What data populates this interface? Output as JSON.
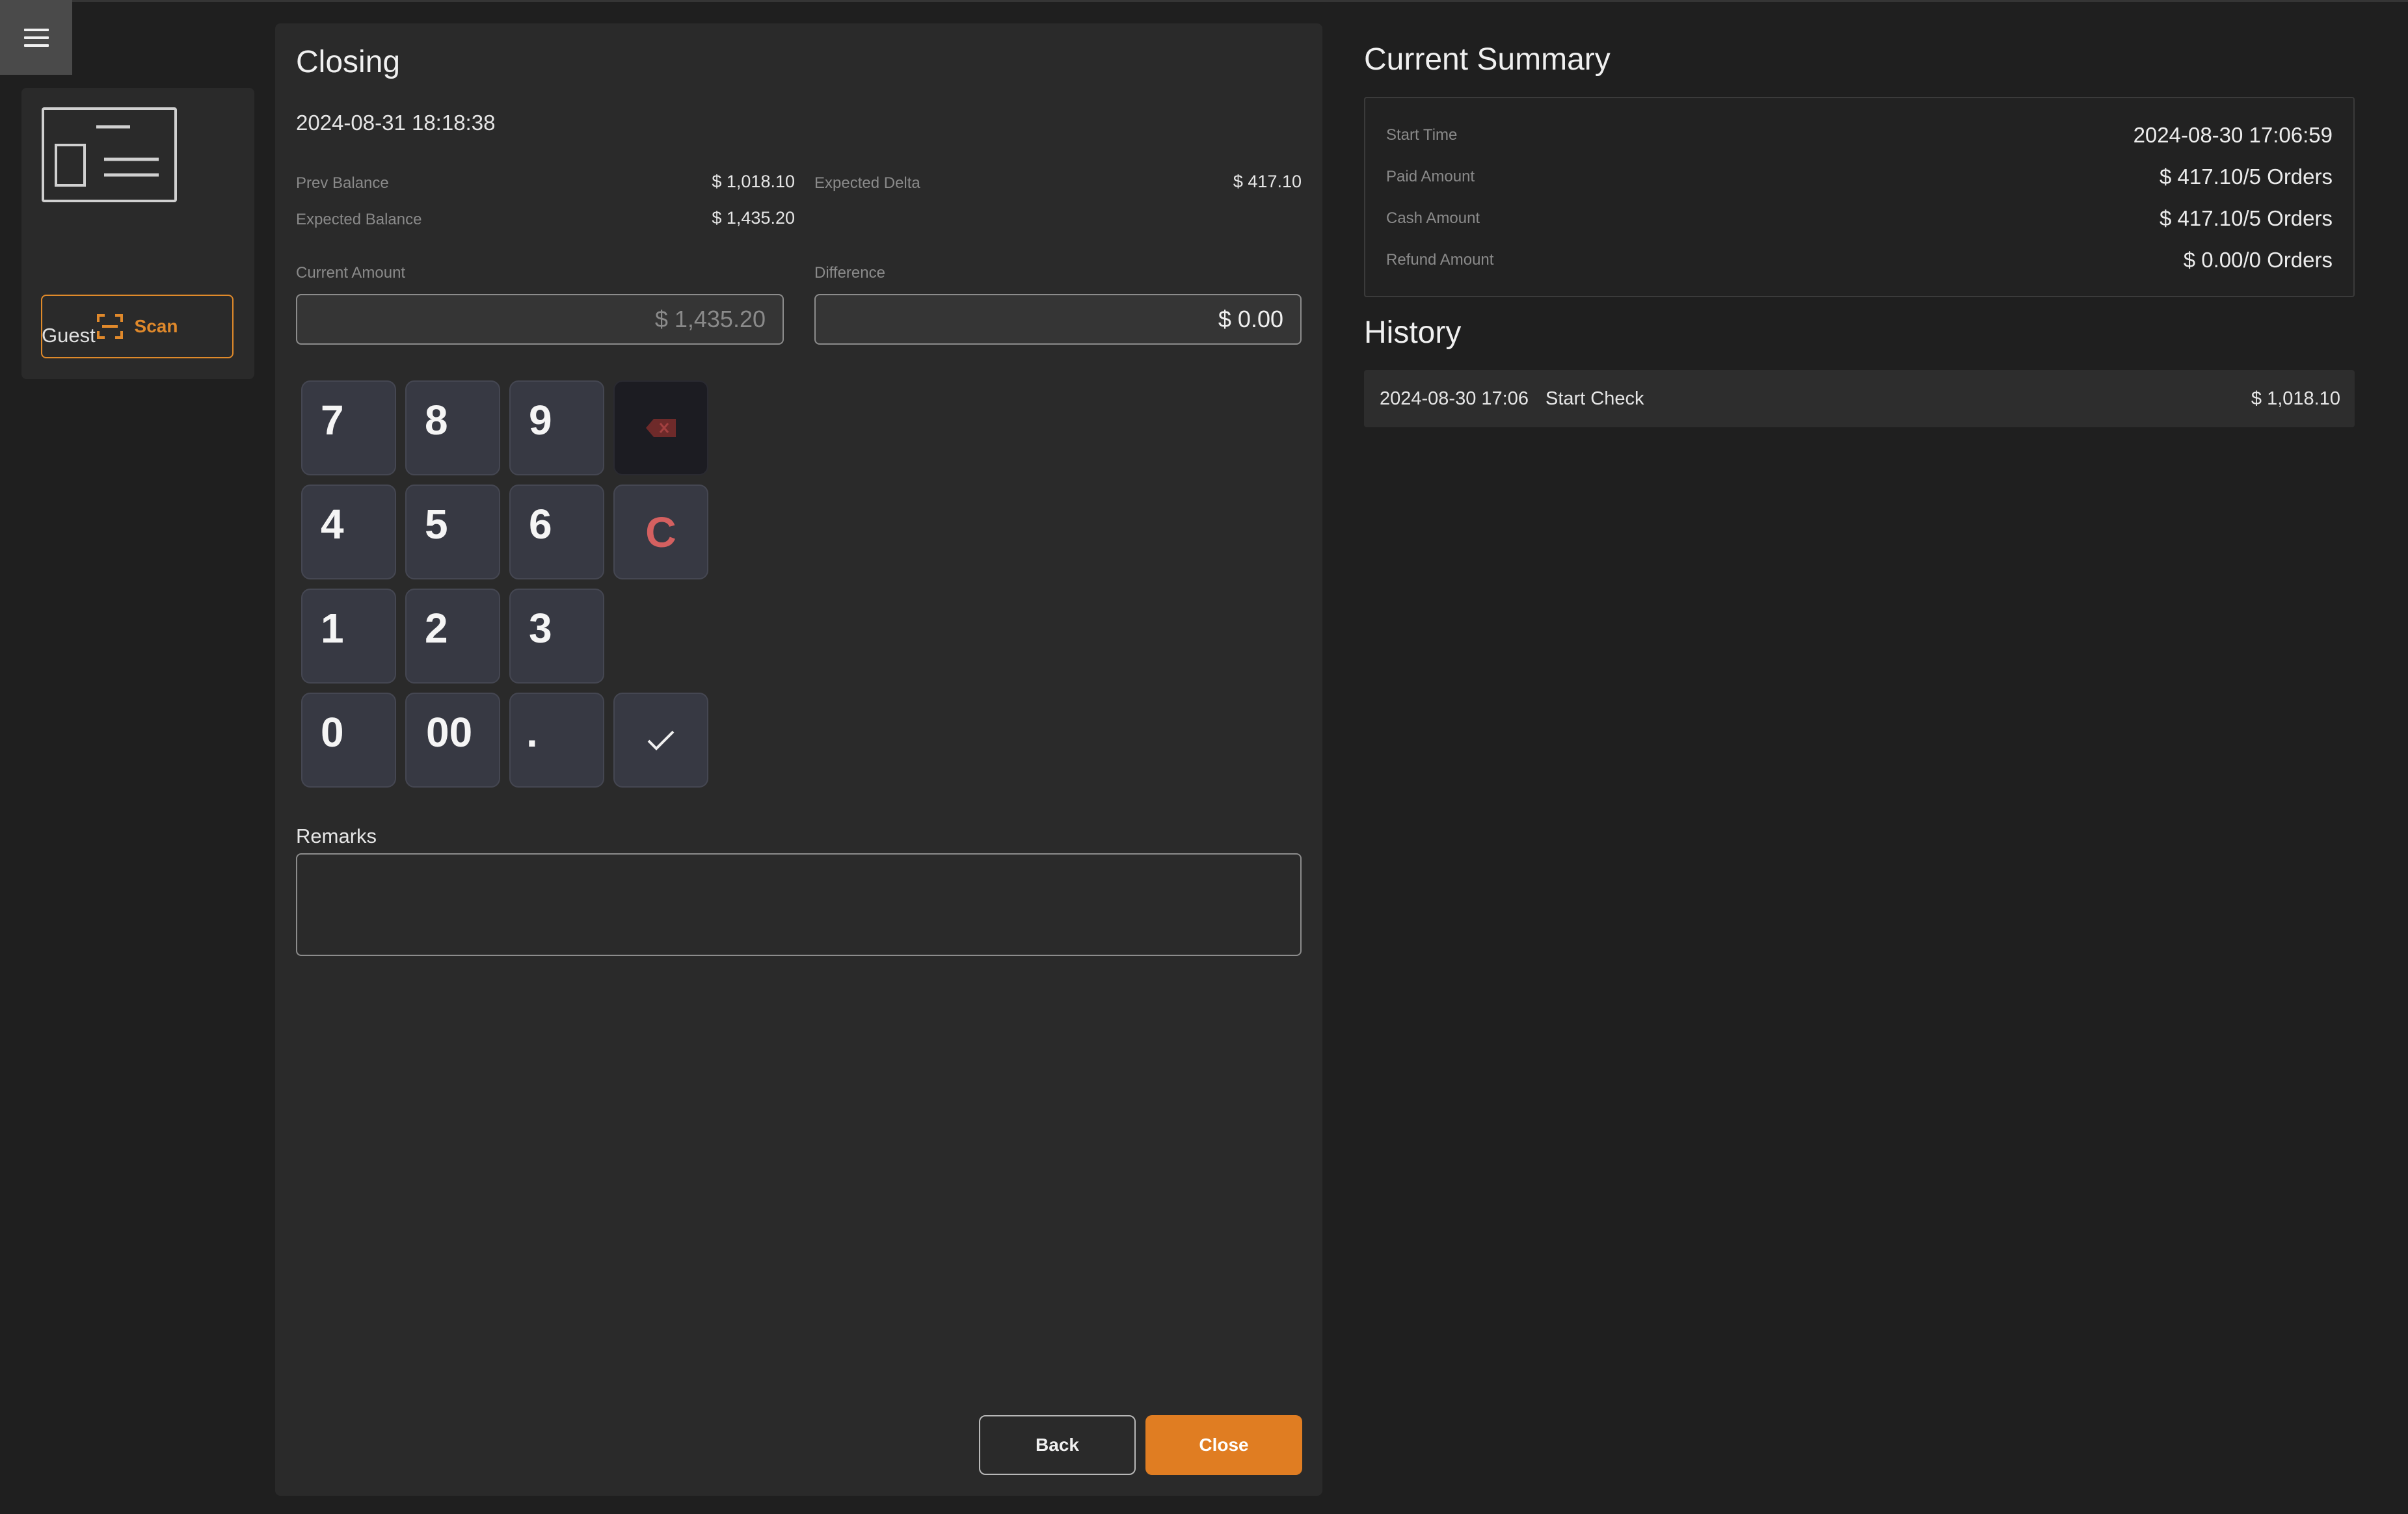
{
  "sidebar": {
    "guest_name": "Guest",
    "scan_label": "Scan"
  },
  "closing": {
    "title": "Closing",
    "datetime": "2024-08-31 18:18:38",
    "prev_balance_label": "Prev Balance",
    "prev_balance_value": "$ 1,018.10",
    "expected_balance_label": "Expected Balance",
    "expected_balance_value": "$ 1,435.20",
    "expected_delta_label": "Expected Delta",
    "expected_delta_value": "$ 417.10",
    "current_amount_label": "Current Amount",
    "current_amount_placeholder": "$ 1,435.20",
    "difference_label": "Difference",
    "difference_value": "$ 0.00",
    "keypad": {
      "k7": "7",
      "k8": "8",
      "k9": "9",
      "k4": "4",
      "k5": "5",
      "k6": "6",
      "clear": "C",
      "k1": "1",
      "k2": "2",
      "k3": "3",
      "k0": "0",
      "k00": "00",
      "dot": "."
    },
    "remarks_label": "Remarks",
    "back_label": "Back",
    "close_label": "Close"
  },
  "summary": {
    "title": "Current Summary",
    "rows": [
      {
        "label": "Start Time",
        "value": "2024-08-30 17:06:59"
      },
      {
        "label": "Paid Amount",
        "value": "$ 417.10/5 Orders"
      },
      {
        "label": "Cash Amount",
        "value": "$ 417.10/5 Orders"
      },
      {
        "label": "Refund Amount",
        "value": "$ 0.00/0 Orders"
      }
    ]
  },
  "history": {
    "title": "History",
    "items": [
      {
        "datetime": "2024-08-30 17:06",
        "event": "Start Check",
        "amount": "$ 1,018.10"
      }
    ]
  },
  "colors": {
    "accent": "#e07d22",
    "clear_key": "#d46060",
    "background": "#1f1f1f",
    "panel": "#2a2a2a"
  },
  "icons": [
    "menu-icon",
    "id-card-icon",
    "scan-icon",
    "backspace-icon",
    "checkmark-icon"
  ]
}
